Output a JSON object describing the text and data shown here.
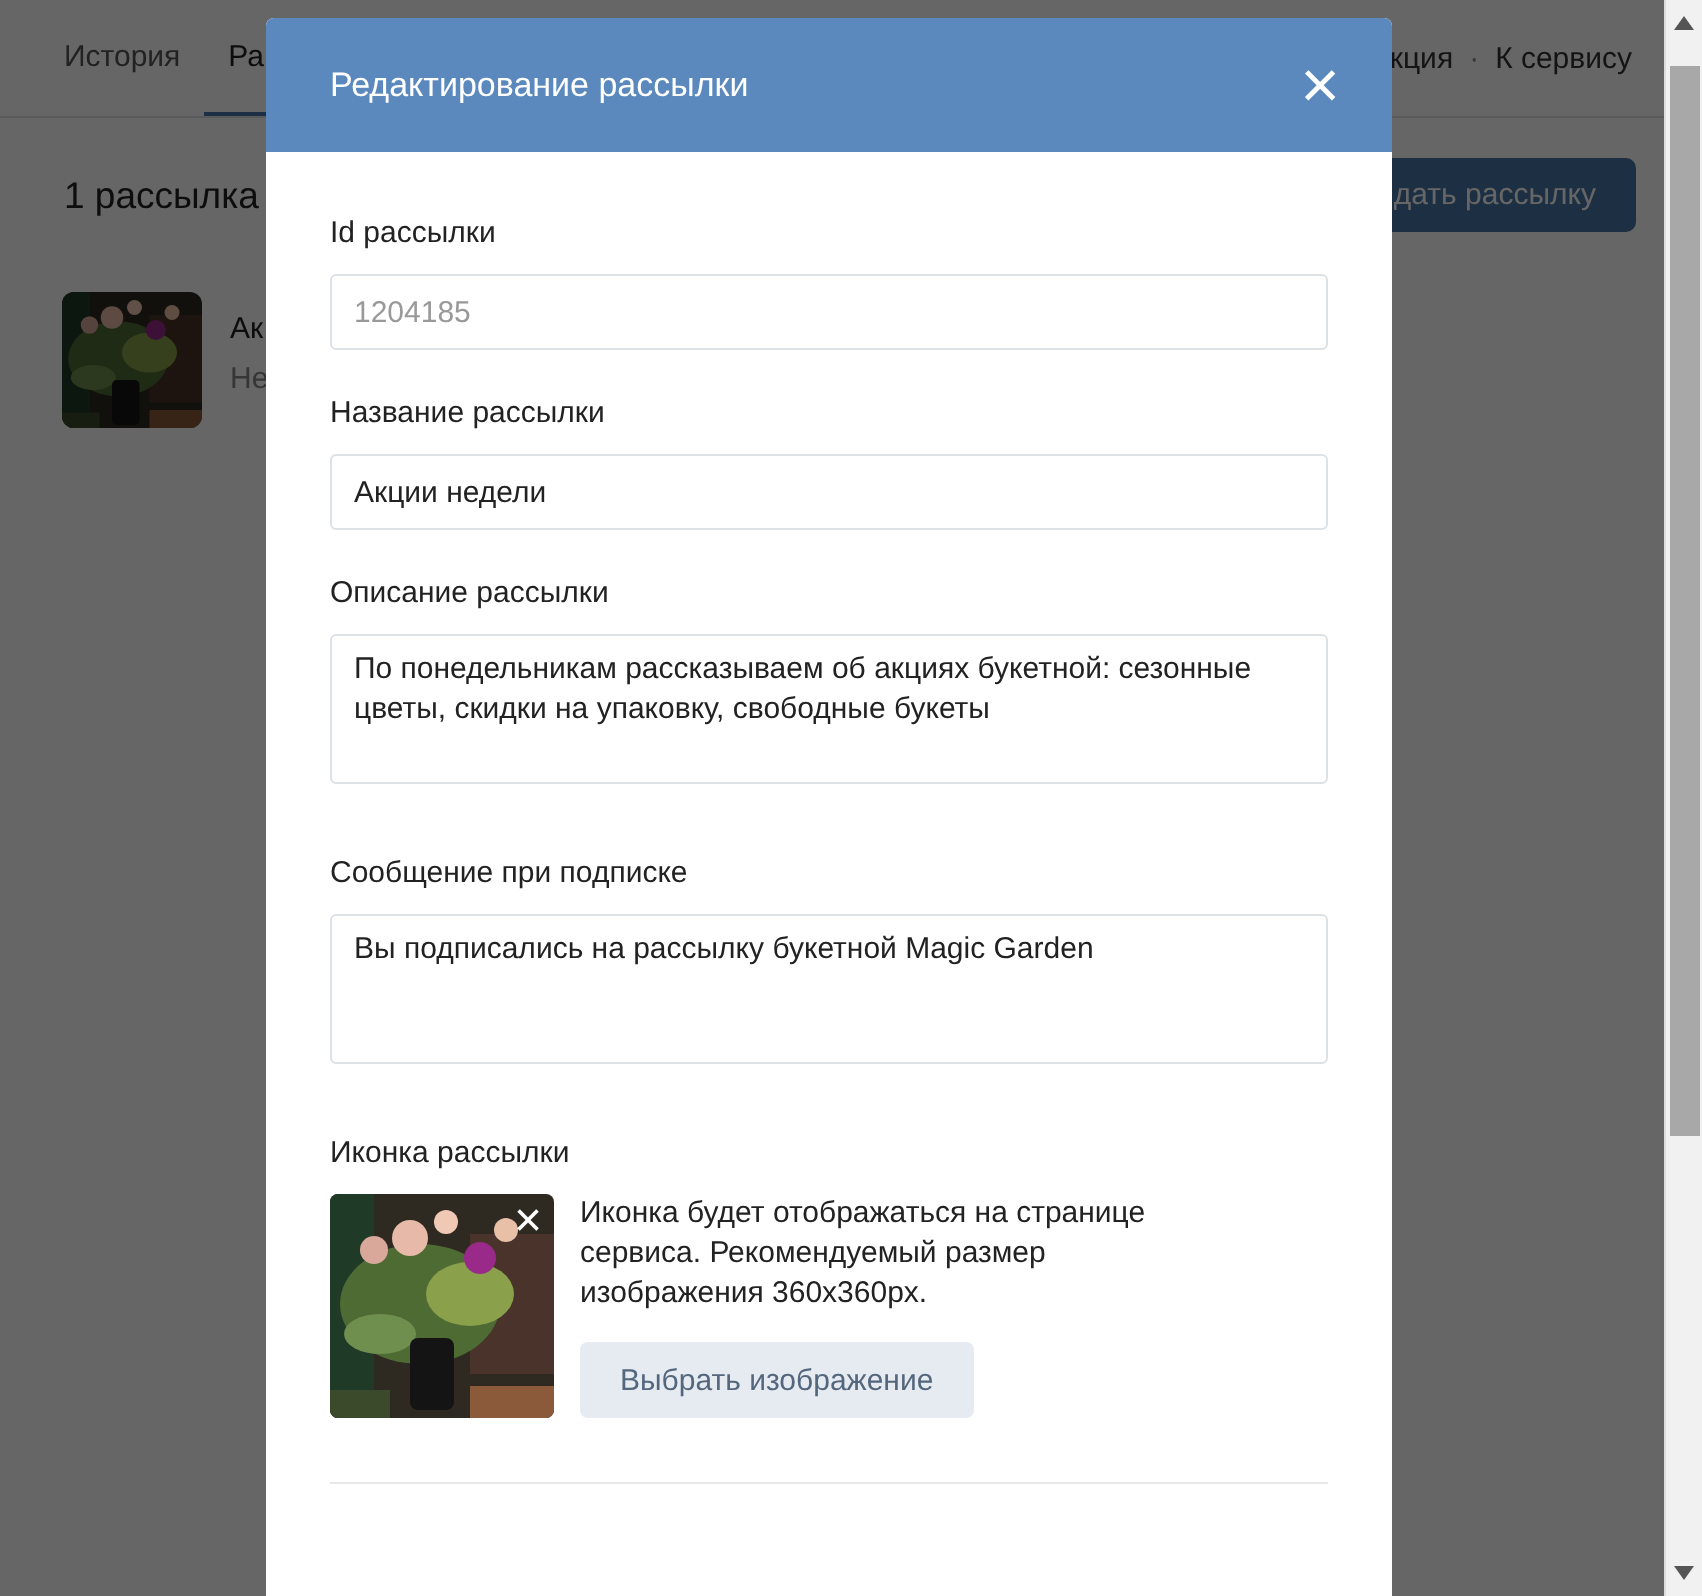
{
  "page": {
    "tabs": [
      {
        "label": "История",
        "selected": false
      },
      {
        "label": "Ра",
        "selected": true
      }
    ],
    "links": [
      "кция",
      "·",
      "К сервису"
    ],
    "count": "1 рассылка",
    "create_button": "дать рассылку",
    "items": [
      {
        "title": "Ак",
        "subtitle": "Не"
      }
    ]
  },
  "dialog": {
    "title": "Редактирование рассылки",
    "close": "×",
    "fields": [
      {
        "kind": "input",
        "label": "Id рассылки",
        "value": "1204185",
        "disabled": true
      },
      {
        "kind": "input",
        "label": "Название рассылки",
        "value": "Акции недели",
        "disabled": false
      },
      {
        "kind": "textarea",
        "label": "Описание рассылки",
        "value": "По понедельникам рассказываем об акциях букетной: сезонные цветы, скидки на упаковку, свободные букеты"
      },
      {
        "kind": "textarea",
        "label": "Сообщение при подписке",
        "value": "Вы подписались на рассылку букетной Magic Garden"
      }
    ],
    "icon_section": {
      "label": "Иконка рассылки",
      "remove": "×",
      "hint": "Иконка будет отображаться на странице сервиса. Рекомендуемый размер изображения 360x360px.",
      "button": "Выбрать изображение"
    }
  }
}
